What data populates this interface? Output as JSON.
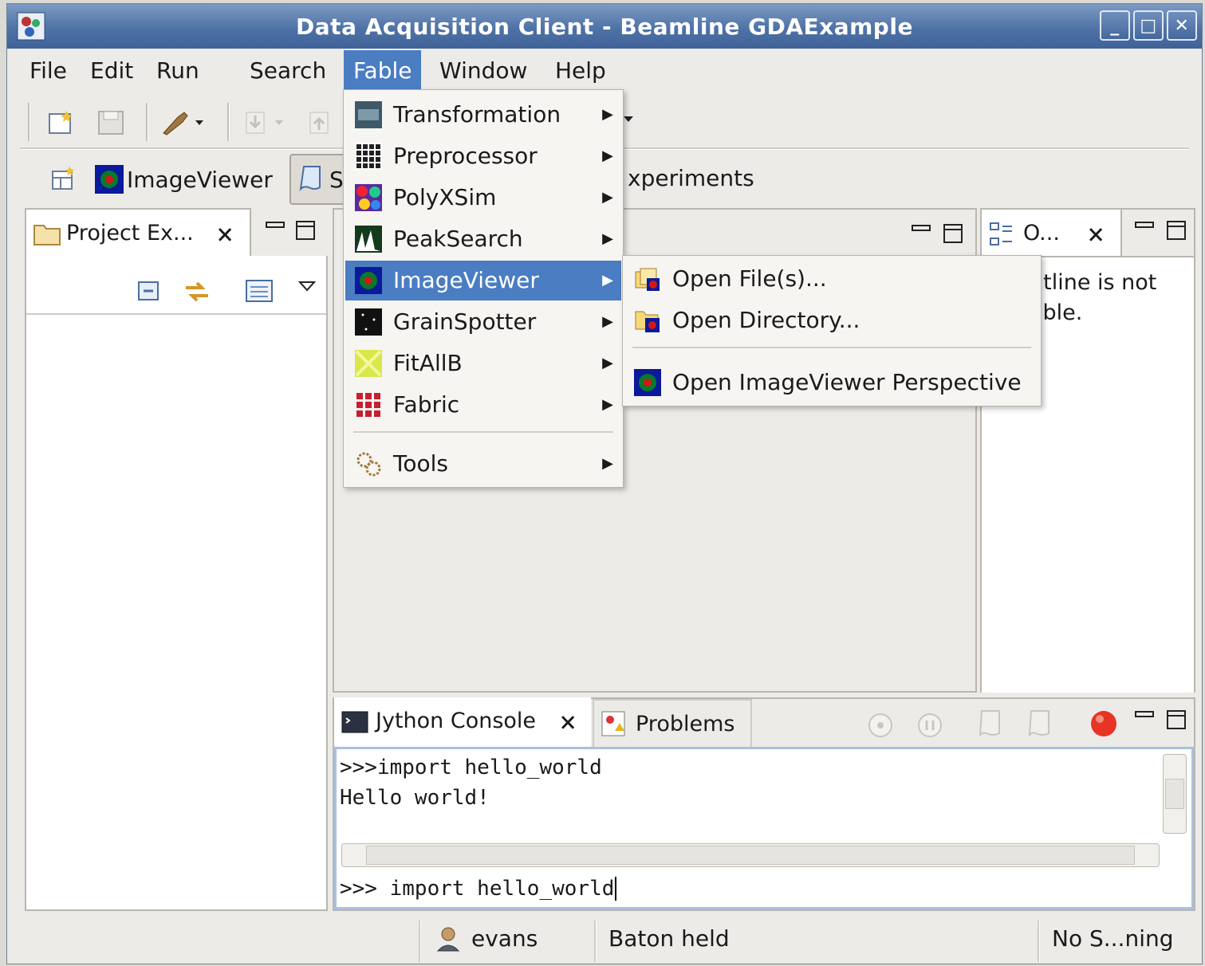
{
  "window": {
    "title": "Data Acquisition Client - Beamline GDAExample"
  },
  "menubar": {
    "file": "File",
    "edit": "Edit",
    "run": "Run",
    "search": "Search",
    "fable": "Fable",
    "window": "Window",
    "help": "Help"
  },
  "perspectives": {
    "imageviewer": "ImageViewer",
    "s_partial": "S",
    "experiments_partial": "xperiments"
  },
  "project_explorer": {
    "tab_label": "Project Ex..."
  },
  "outline": {
    "tab_label": "O...",
    "message_line1": "utline is not",
    "message_line2": "able."
  },
  "fable_menu": {
    "items": [
      {
        "label": "Transformation"
      },
      {
        "label": "Preprocessor"
      },
      {
        "label": "PolyXSim"
      },
      {
        "label": "PeakSearch"
      },
      {
        "label": "ImageViewer"
      },
      {
        "label": "GrainSpotter"
      },
      {
        "label": "FitAllB"
      },
      {
        "label": "Fabric"
      },
      {
        "label": "Tools"
      }
    ]
  },
  "imageviewer_submenu": {
    "items": [
      {
        "label": "Open File(s)..."
      },
      {
        "label": "Open Directory..."
      },
      {
        "label": "Open ImageViewer Perspective"
      }
    ]
  },
  "console": {
    "tab_label": "Jython Console",
    "problems_label": "Problems",
    "output_line1": ">>>import hello_world",
    "output_line2": "Hello world!",
    "input_value": ">>> import hello_world"
  },
  "status": {
    "user": "evans",
    "baton": "Baton held",
    "scan": "No S...ning"
  },
  "colors": {
    "accent": "#4a7dc2",
    "titlebar": "#4f72a6"
  }
}
